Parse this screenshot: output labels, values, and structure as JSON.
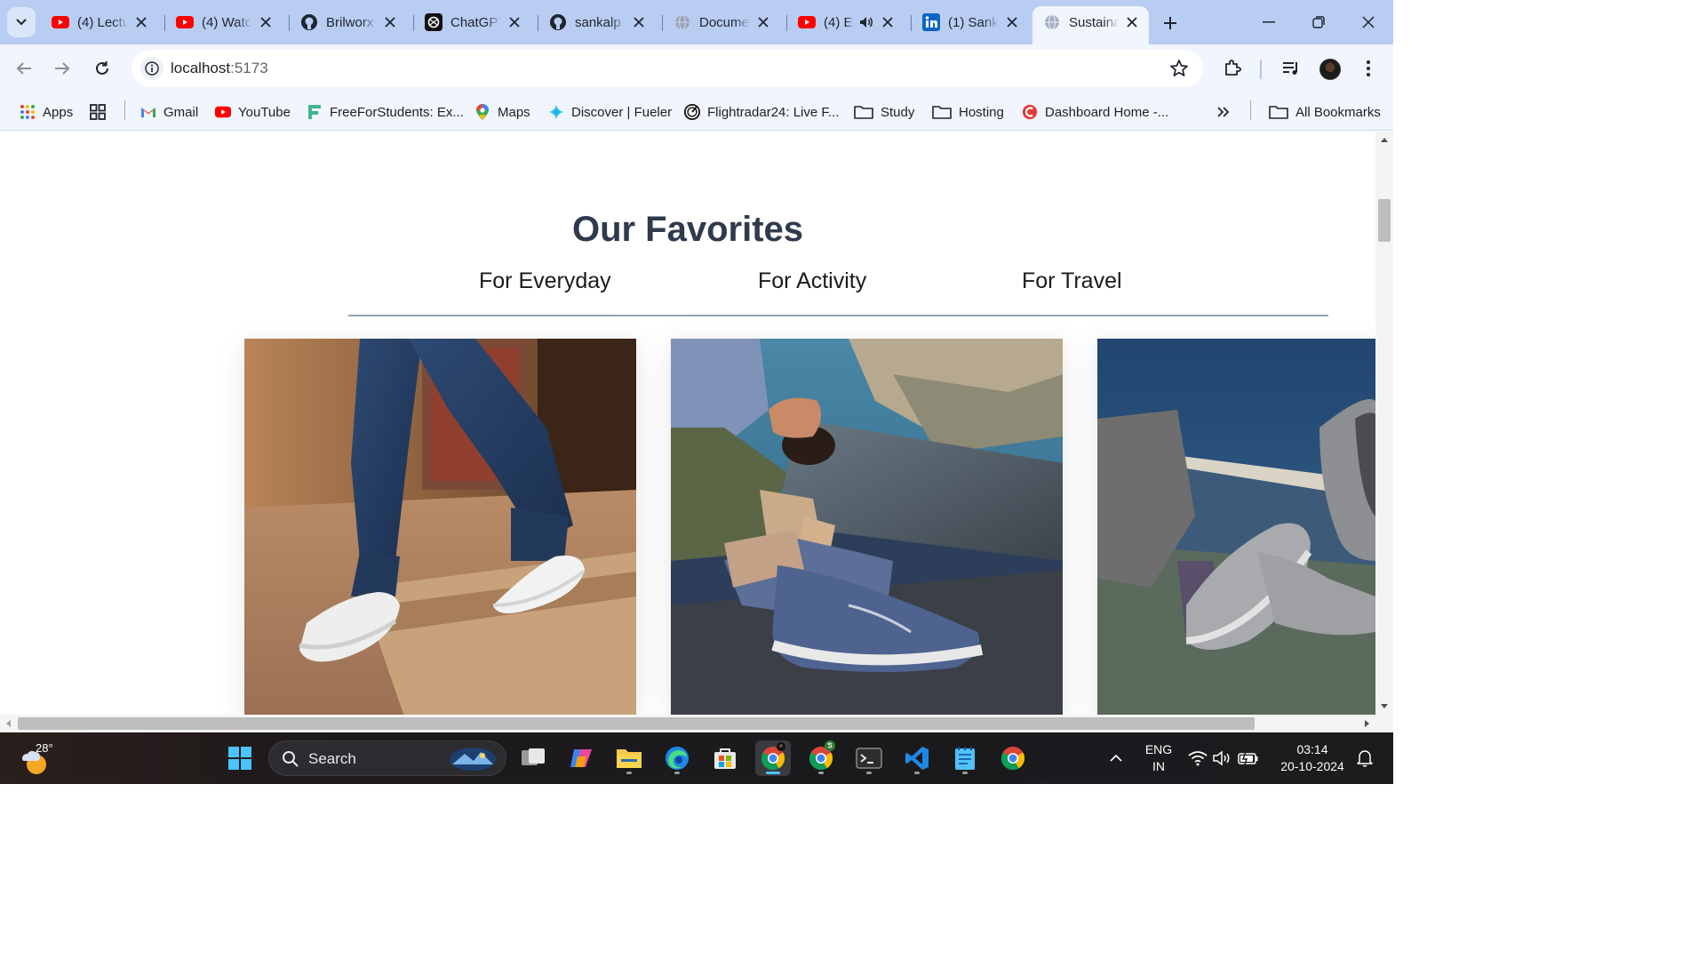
{
  "browser": {
    "tabs": [
      {
        "title": "(4) Lectu",
        "icon": "youtube-icon"
      },
      {
        "title": "(4) Watc",
        "icon": "youtube-icon"
      },
      {
        "title": "Brilworx",
        "icon": "github-icon"
      },
      {
        "title": "ChatGPT",
        "icon": "chatgpt-icon"
      },
      {
        "title": "sankalp",
        "icon": "github-icon"
      },
      {
        "title": "Docume",
        "icon": "globe-icon"
      },
      {
        "title": "(4) E",
        "icon": "youtube-icon"
      },
      {
        "title": "(1) Sank",
        "icon": "linkedin-icon"
      },
      {
        "title": "Sustaina",
        "icon": "globe-icon",
        "active": true
      }
    ],
    "address": {
      "host": "localhost",
      "port": ":5173"
    },
    "bookmarks": [
      {
        "label": "Apps",
        "icon": "apps-grid-icon"
      },
      {
        "label": "",
        "icon": "tab-groups-icon"
      },
      {
        "label": "Gmail",
        "icon": "gmail-icon"
      },
      {
        "label": "YouTube",
        "icon": "youtube-icon"
      },
      {
        "label": "FreeForStudents: Ex...",
        "icon": "freeforstudents-icon"
      },
      {
        "label": "Maps",
        "icon": "maps-icon"
      },
      {
        "label": "Discover | Fueler",
        "icon": "fueler-icon"
      },
      {
        "label": "Flightradar24: Live F...",
        "icon": "flightradar-icon"
      },
      {
        "label": "Study",
        "icon": "folder-icon"
      },
      {
        "label": "Hosting",
        "icon": "folder-icon"
      },
      {
        "label": "Dashboard Home -...",
        "icon": "dashboard-icon"
      }
    ],
    "all_bookmarks_label": "All Bookmarks",
    "colors": {
      "tabstrip": "#b9cdf2",
      "toolbar": "#f1f5fd"
    }
  },
  "page": {
    "section_title": "Our Favorites",
    "categories": [
      "For Everyday",
      "For Activity",
      "For Travel"
    ],
    "cards": [
      {
        "image": "white-wool-sneakers-photo"
      },
      {
        "image": "blue-wool-shoe-on-bench-photo"
      },
      {
        "image": "grey-wool-shoes-by-sea-photo"
      }
    ]
  },
  "taskbar": {
    "weather_temp": "28°",
    "search_label": "Search",
    "language": [
      "ENG",
      "IN"
    ],
    "time": "03:14",
    "date": "20-10-2024"
  }
}
